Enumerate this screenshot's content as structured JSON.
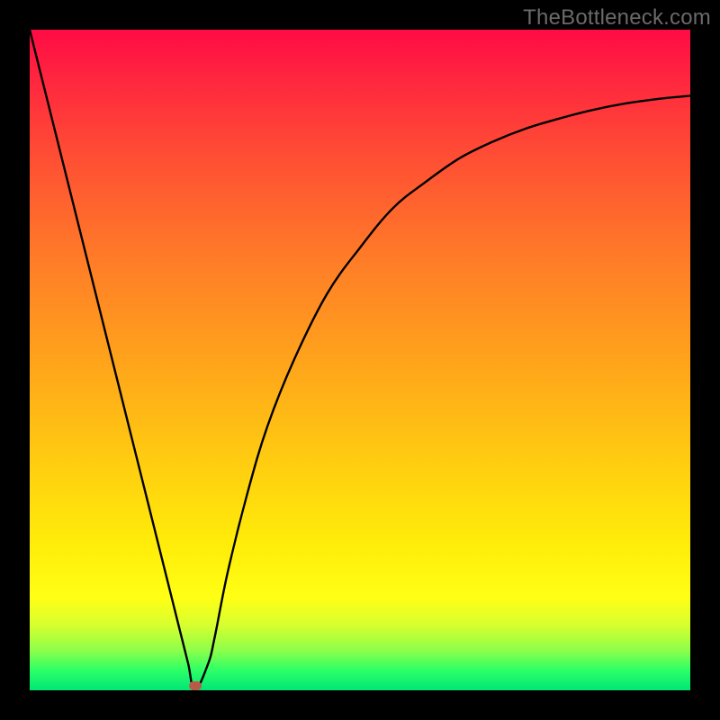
{
  "watermark_text": "TheBottleneck.com",
  "chart_data": {
    "type": "line",
    "title": "",
    "xlabel": "",
    "ylabel": "",
    "xlim": [
      0,
      100
    ],
    "ylim": [
      0,
      100
    ],
    "grid": false,
    "legend": false,
    "series": [
      {
        "name": "bottleneck-curve",
        "color": "#000000",
        "x": [
          0,
          5,
          10,
          15,
          20,
          23,
          24,
          25,
          27,
          28,
          30,
          33,
          36,
          40,
          45,
          50,
          55,
          60,
          65,
          70,
          75,
          80,
          85,
          90,
          95,
          100
        ],
        "y": [
          100,
          80,
          60,
          40,
          20,
          8,
          4,
          0,
          4,
          8,
          18,
          30,
          40,
          50,
          60,
          67,
          73,
          77,
          80.5,
          83,
          85,
          86.5,
          87.8,
          88.8,
          89.5,
          90
        ]
      }
    ],
    "annotations": [
      {
        "name": "optimal-marker",
        "x": 25,
        "y": 0.7,
        "color": "#b85a4a"
      }
    ],
    "background_gradient": {
      "direction": "vertical",
      "stops": [
        {
          "pos": 0.0,
          "color": "#ff0b45"
        },
        {
          "pos": 0.5,
          "color": "#ffa31b"
        },
        {
          "pos": 0.86,
          "color": "#ffff14"
        },
        {
          "pos": 1.0,
          "color": "#00e676"
        }
      ]
    }
  }
}
